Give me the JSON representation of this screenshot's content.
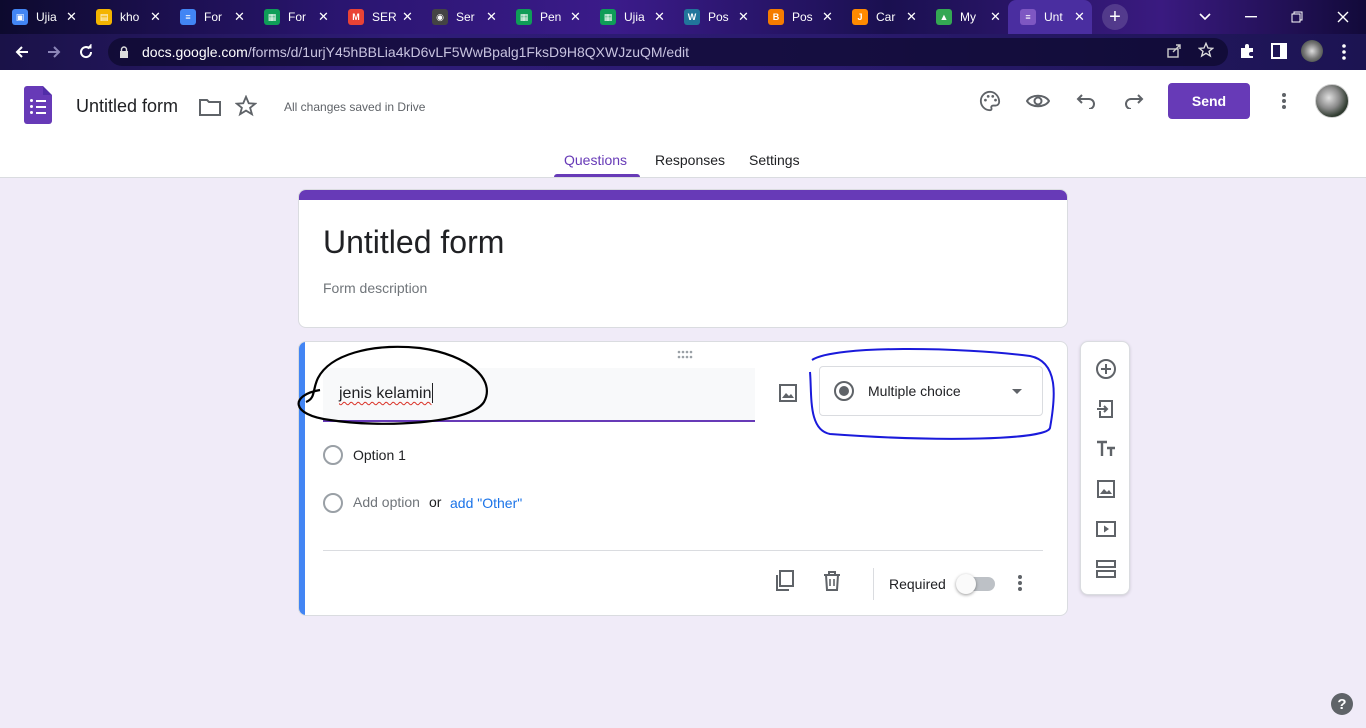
{
  "browser": {
    "tabs": [
      {
        "label": "Ujia",
        "color": "#4285f4",
        "glyph": "▣"
      },
      {
        "label": "kho",
        "color": "#f4b400",
        "glyph": "▤"
      },
      {
        "label": "For",
        "color": "#4285f4",
        "glyph": "≡"
      },
      {
        "label": "For",
        "color": "#0f9d58",
        "glyph": "▦"
      },
      {
        "label": "SER",
        "color": "#ea4335",
        "glyph": "M"
      },
      {
        "label": "Ser",
        "color": "#444444",
        "glyph": "◉"
      },
      {
        "label": "Pen",
        "color": "#0f9d58",
        "glyph": "▦"
      },
      {
        "label": "Ujia",
        "color": "#0f9d58",
        "glyph": "▦"
      },
      {
        "label": "Pos",
        "color": "#21759b",
        "glyph": "W"
      },
      {
        "label": "Pos",
        "color": "#f57c00",
        "glyph": "B"
      },
      {
        "label": "Car",
        "color": "#ff8a00",
        "glyph": "J"
      },
      {
        "label": "My",
        "color": "#34a853",
        "glyph": "▲"
      },
      {
        "label": "Unt",
        "color": "#7e57c2",
        "glyph": "≡",
        "active": true
      }
    ],
    "tab_close": "✕",
    "new_tab": "+",
    "url_host": "docs.google.com",
    "url_path": "/forms/d/1urjY45hBBLia4kD6vLF5WwBpalg1FksD9H8QXWJzuQM/edit"
  },
  "header": {
    "doc_title": "Untitled form",
    "saved_status": "All changes saved in Drive",
    "send_label": "Send"
  },
  "nav_tabs": {
    "questions": "Questions",
    "responses": "Responses",
    "settings": "Settings"
  },
  "form": {
    "title": "Untitled form",
    "description_placeholder": "Form description"
  },
  "question": {
    "text": "jenis kelamin",
    "type": "Multiple choice",
    "option1": "Option 1",
    "add_option": "Add option",
    "or": "or",
    "add_other": "add \"Other\"",
    "required_label": "Required",
    "required_on": false
  },
  "help": "?",
  "colors": {
    "accent": "#673ab7",
    "page_bg": "#f0ebf8",
    "active_question_bar": "#4285f4",
    "link": "#1a73e8",
    "annotation_black": "#000000",
    "annotation_blue": "#1a1adb"
  }
}
